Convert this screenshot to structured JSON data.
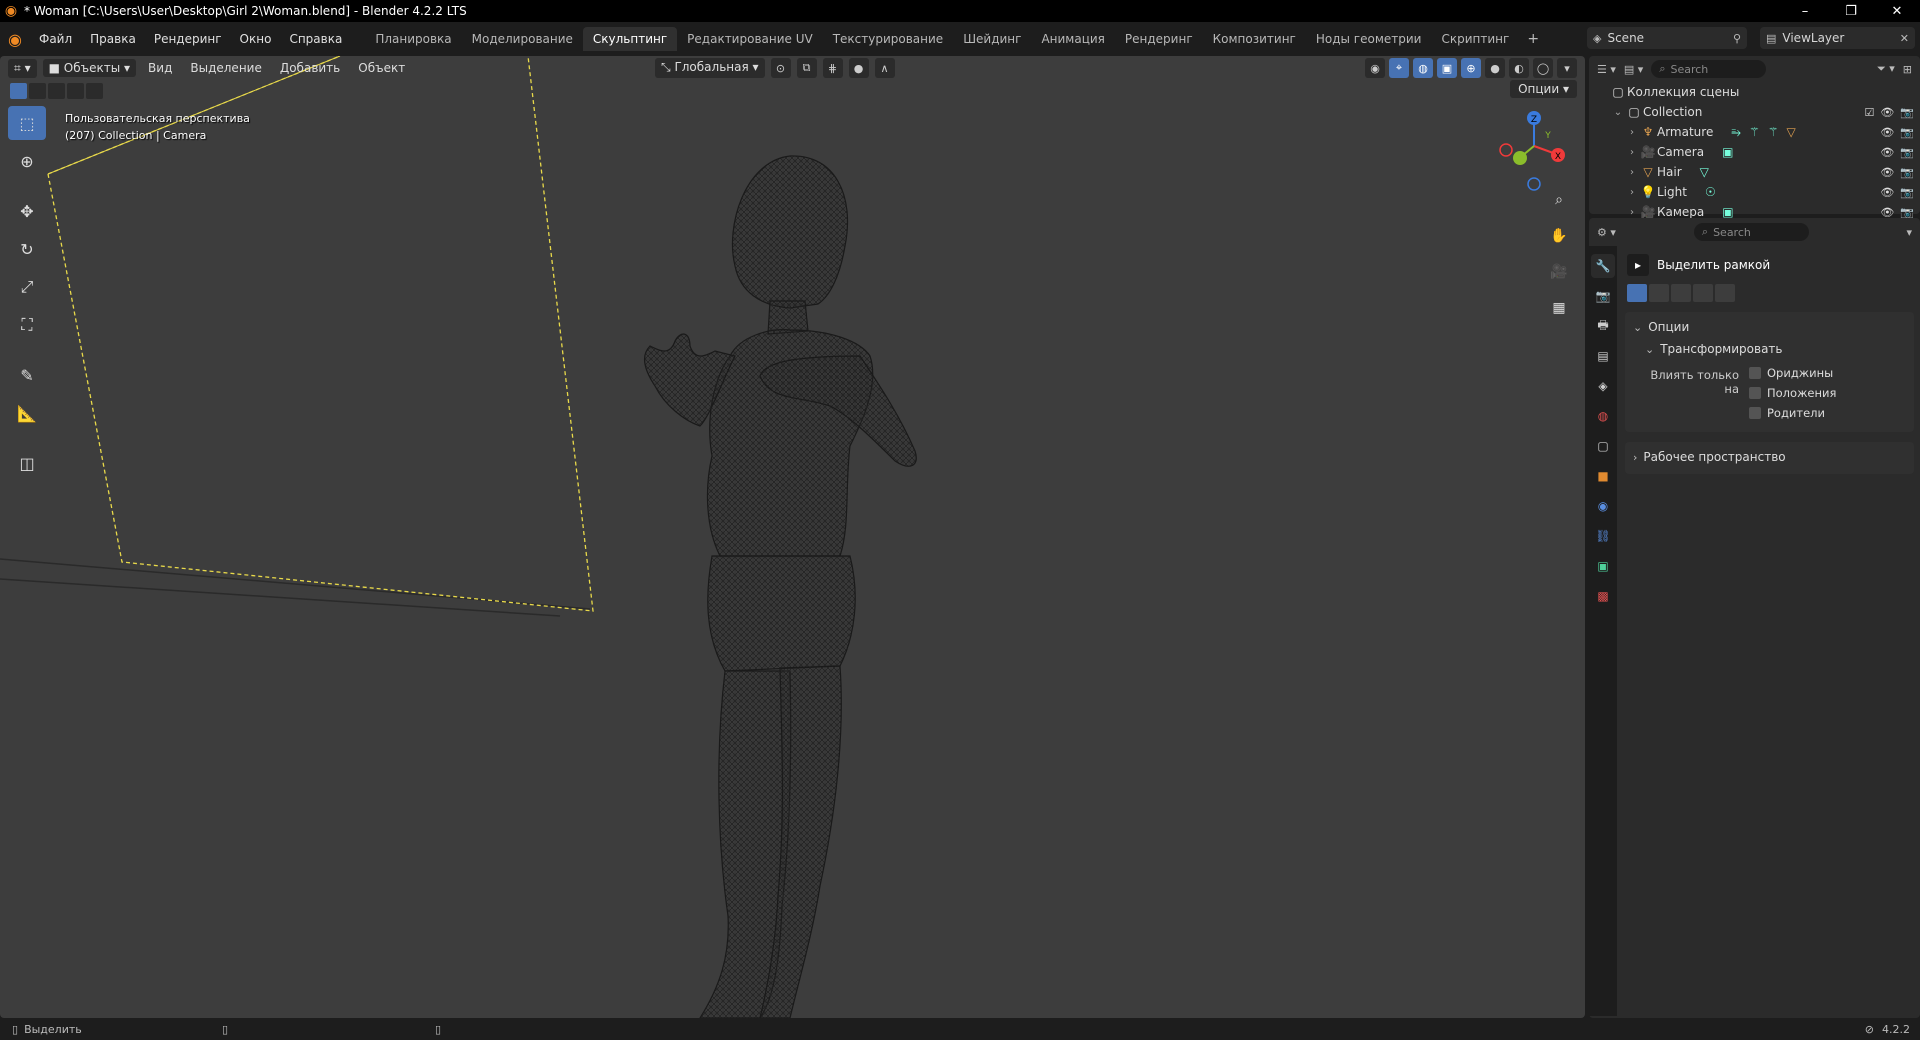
{
  "window": {
    "title": "* Woman [C:\\Users\\User\\Desktop\\Girl 2\\Woman.blend] - Blender 4.2.2 LTS",
    "minimize": "–",
    "maximize": "❐",
    "close": "✕"
  },
  "menu": {
    "items": [
      "Файл",
      "Правка",
      "Рендеринг",
      "Окно",
      "Справка"
    ]
  },
  "workspaces": {
    "tabs": [
      "Планировка",
      "Моделирование",
      "Скульптинг",
      "Редактирование UV",
      "Текстурирование",
      "Шейдинг",
      "Анимация",
      "Рендеринг",
      "Композитинг",
      "Ноды геометрии",
      "Скриптинг"
    ],
    "active_index": 2,
    "add": "+"
  },
  "scene": {
    "label": "Scene"
  },
  "view_layer": {
    "label": "ViewLayer"
  },
  "viewport": {
    "mode": "Объекты",
    "menus": [
      "Вид",
      "Выделение",
      "Добавить",
      "Объект"
    ],
    "orientation": "Глобальная",
    "options": "Опции",
    "info_line1": "Пользовательская перспектива",
    "info_line2": "(207) Collection | Camera"
  },
  "gizmo": {
    "x": "X",
    "y": "Y",
    "z": "Z",
    "colors": {
      "x": "#f03a3a",
      "y": "#8bbd2b",
      "z": "#3a7bde"
    }
  },
  "outliner": {
    "search_placeholder": "Search",
    "scene_collection": "Коллекция сцены",
    "collection": "Collection",
    "items": [
      {
        "name": "Armature",
        "icon": "armature-icon",
        "color": "#e0a050"
      },
      {
        "name": "Camera",
        "icon": "camera-icon",
        "color": "#e0a050"
      },
      {
        "name": "Hair",
        "icon": "hair-icon",
        "color": "#e0a050"
      },
      {
        "name": "Light",
        "icon": "light-icon",
        "color": "#e0a050"
      },
      {
        "name": "Камера",
        "icon": "camera-icon",
        "color": "#e0a050"
      }
    ]
  },
  "properties": {
    "search_placeholder": "Search",
    "tool_name": "Выделить рамкой",
    "panel_options": "Опции",
    "sub_transform": "Трансформировать",
    "affect_label": "Влиять только на",
    "checks": [
      "Ориджины",
      "Положения",
      "Родители"
    ],
    "panel_workspace": "Рабочее пространство"
  },
  "status": {
    "select": "Выделить",
    "version": "4.2.2"
  },
  "accent": "#4772b3"
}
